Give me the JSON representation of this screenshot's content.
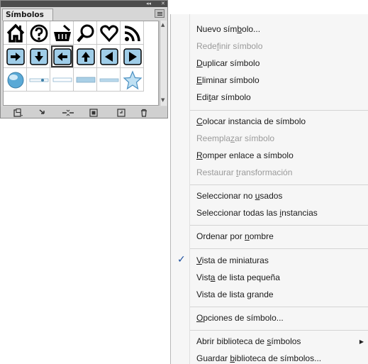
{
  "panel": {
    "title": "Símbolos",
    "collapse_icon": "collapse-arrows-icon",
    "close_icon": "close-icon",
    "collapse_text": "◂◂",
    "close_text": "✕",
    "symbols_row1": [
      "home-icon",
      "help-icon",
      "basket-icon",
      "search-icon",
      "heart-icon",
      "rss-icon"
    ],
    "symbols_row2": [
      "arrow-right-button",
      "arrow-down-button",
      "arrow-left-button",
      "arrow-up-button",
      "arrow-left-triangle-button",
      "arrow-right-triangle-button"
    ],
    "symbols_row3": [
      "globe-icon",
      "slider-bar",
      "empty-bar",
      "blue-bar",
      "thin-blue-bar",
      "star-icon"
    ],
    "bottom_icons": [
      "symbol-library-menu",
      "place-symbol-instance",
      "break-link",
      "symbol-options",
      "new-symbol",
      "delete-symbol"
    ]
  },
  "menu": {
    "items": [
      {
        "text": "Nuevo sím",
        "ul": "b",
        "rest": "olo..."
      },
      {
        "text": "Rede",
        "ul": "f",
        "rest": "inir símbolo"
      },
      {
        "text": "",
        "ul": "D",
        "rest": "uplicar símbolo"
      },
      {
        "text": "",
        "ul": "E",
        "rest": "liminar símbolo"
      },
      {
        "text": "Edi",
        "ul": "t",
        "rest": "ar símbolo"
      },
      {
        "text": "",
        "ul": "C",
        "rest": "olocar instancia de símbolo"
      },
      {
        "text": "Reempla",
        "ul": "z",
        "rest": "ar símbolo"
      },
      {
        "text": "",
        "ul": "R",
        "rest": "omper enlace a símbolo"
      },
      {
        "text": "Restaurar ",
        "ul": "t",
        "rest": "ransformación"
      },
      {
        "text": "Seleccionar no ",
        "ul": "u",
        "rest": "sados"
      },
      {
        "text": "Seleccionar todas las ",
        "ul": "i",
        "rest": "nstancias"
      },
      {
        "text": "Ordenar por ",
        "ul": "n",
        "rest": "ombre"
      },
      {
        "text": "",
        "ul": "V",
        "rest": "ista de miniaturas"
      },
      {
        "text": "Vist",
        "ul": "a",
        "rest": " de lista pequeña"
      },
      {
        "text": "Vista de lista ",
        "ul": "g",
        "rest": "rande"
      },
      {
        "text": "",
        "ul": "O",
        "rest": "pciones de símbolo..."
      },
      {
        "text": "Abrir biblioteca de ",
        "ul": "s",
        "rest": "ímbolos"
      },
      {
        "text": "Guardar ",
        "ul": "b",
        "rest": "iblioteca de símbolos..."
      }
    ],
    "checkmark": "✓",
    "submenu_arrow": "▶"
  }
}
